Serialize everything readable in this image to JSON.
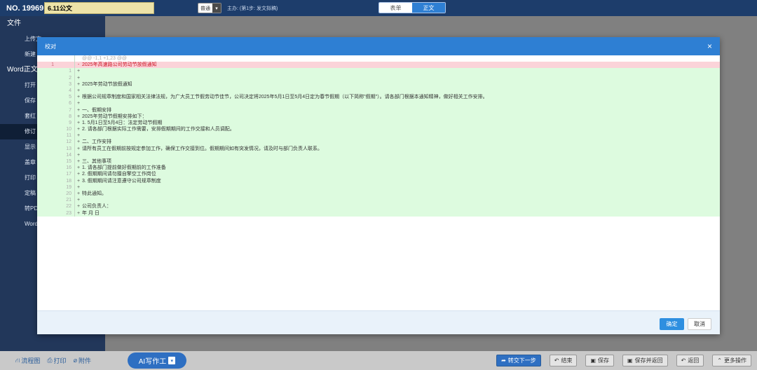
{
  "topbar": {
    "doc_no": "NO. 19969",
    "title_value": "6.11公文",
    "select_value": "普通",
    "step_text": "主办: (第1步: 发文拟稿)",
    "tab_form": "表单",
    "tab_body": "正文"
  },
  "leftmenu": {
    "section_file": "文件",
    "item_upload": "上传文",
    "item_new": "新建",
    "section_word": "Word正文",
    "item_open": "打开",
    "item_save": "保存",
    "item_redhead": "套红",
    "item_revise": "修订",
    "item_show": "显示",
    "item_seal": "盖章",
    "item_print": "打印",
    "item_finalize": "定稿",
    "item_topdf": "转PD",
    "item_word": "Word"
  },
  "modal": {
    "title": "校对",
    "close_icon": "×",
    "ok_label": "确定",
    "cancel_label": "取消"
  },
  "diff": {
    "hunk": "@@ -1,1 +1,23 @@",
    "rows": [
      {
        "type": "del",
        "ln1": "1",
        "ln2": "",
        "mk": "-",
        "text": "2025年高速路公司劳动节放假通知"
      },
      {
        "type": "add",
        "ln1": "",
        "ln2": "1",
        "mk": "+",
        "text": ""
      },
      {
        "type": "add",
        "ln1": "",
        "ln2": "2",
        "mk": "+",
        "text": ""
      },
      {
        "type": "add",
        "ln1": "",
        "ln2": "3",
        "mk": "+",
        "text": "2025年劳动节放假通知"
      },
      {
        "type": "add",
        "ln1": "",
        "ln2": "4",
        "mk": "+",
        "text": ""
      },
      {
        "type": "add",
        "ln1": "",
        "ln2": "5",
        "mk": "+",
        "text": "根据公司规章制度和国家相关法律法规，为广大员工节假劳动节佳节，公司决定将2025年5月1日至5月4日定为春节假期（以下简称\"假期\"）。请各部门根据本通知精神，做好相关工作安排。"
      },
      {
        "type": "add",
        "ln1": "",
        "ln2": "6",
        "mk": "+",
        "text": ""
      },
      {
        "type": "add",
        "ln1": "",
        "ln2": "7",
        "mk": "+",
        "text": "一、假期安排"
      },
      {
        "type": "add",
        "ln1": "",
        "ln2": "8",
        "mk": "+",
        "text": "2025年劳动节假期安排如下："
      },
      {
        "type": "add",
        "ln1": "",
        "ln2": "9",
        "mk": "+",
        "text": "1. 5月1日至5月4日：法定劳动节假期"
      },
      {
        "type": "add",
        "ln1": "",
        "ln2": "10",
        "mk": "+",
        "text": "2. 请各部门根据实际工作需要，安排假期期间的工作交接和人员调配。"
      },
      {
        "type": "add",
        "ln1": "",
        "ln2": "11",
        "mk": "+",
        "text": ""
      },
      {
        "type": "add",
        "ln1": "",
        "ln2": "12",
        "mk": "+",
        "text": "二、工作安排"
      },
      {
        "type": "add",
        "ln1": "",
        "ln2": "13",
        "mk": "+",
        "text": "请所有员工在假期前按规定参加工作，确保工作交接到位。假期期间如有突发情况，请及时与部门负责人联系。"
      },
      {
        "type": "add",
        "ln1": "",
        "ln2": "14",
        "mk": "+",
        "text": ""
      },
      {
        "type": "add",
        "ln1": "",
        "ln2": "15",
        "mk": "+",
        "text": "三、其他事项"
      },
      {
        "type": "add",
        "ln1": "",
        "ln2": "16",
        "mk": "+",
        "text": "1. 请各部门提前做好假期前的工作准备"
      },
      {
        "type": "add",
        "ln1": "",
        "ln2": "17",
        "mk": "+",
        "text": "2. 假期期间请勿擅自擎空工作岗位"
      },
      {
        "type": "add",
        "ln1": "",
        "ln2": "18",
        "mk": "+",
        "text": "3. 假期期间请注意遵守公司规章制度"
      },
      {
        "type": "add",
        "ln1": "",
        "ln2": "19",
        "mk": "+",
        "text": ""
      },
      {
        "type": "add",
        "ln1": "",
        "ln2": "20",
        "mk": "+",
        "text": "特此通知。"
      },
      {
        "type": "add",
        "ln1": "",
        "ln2": "21",
        "mk": "+",
        "text": ""
      },
      {
        "type": "add",
        "ln1": "",
        "ln2": "22",
        "mk": "+",
        "text": "公司负责人："
      },
      {
        "type": "add",
        "ln1": "",
        "ln2": "23",
        "mk": "+",
        "text": "年  月  日"
      }
    ]
  },
  "bottombar": {
    "flowchart": "流程图",
    "print": "打印",
    "attachment": "附件",
    "ai_label": "AI写作工",
    "btn_next": "转交下一步",
    "btn_end": "结束",
    "btn_save": "保存",
    "btn_save_return": "保存并返回",
    "btn_return": "返回",
    "btn_more": "更多操作"
  },
  "colors": {
    "topbar": "#1d3d6b",
    "accent": "#2e7fd3",
    "diff_add": "#ddfbdf",
    "diff_del": "#fbd3d9"
  }
}
